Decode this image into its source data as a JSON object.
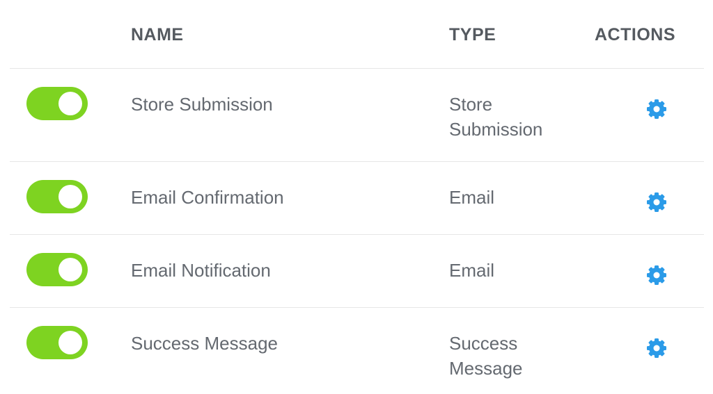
{
  "colors": {
    "toggle_on": "#7ed321",
    "gear": "#2b9be8",
    "text": "#646970",
    "header_text": "#555a60",
    "divider": "#e6e6e6"
  },
  "header": {
    "name": "NAME",
    "type": "TYPE",
    "actions": "ACTIONS"
  },
  "rows": [
    {
      "enabled": true,
      "name": "Store Submission",
      "type": "Store Submission",
      "action_icon": "gear-icon"
    },
    {
      "enabled": true,
      "name": "Email Confirmation",
      "type": "Email",
      "action_icon": "gear-icon"
    },
    {
      "enabled": true,
      "name": "Email Notification",
      "type": "Email",
      "action_icon": "gear-icon"
    },
    {
      "enabled": true,
      "name": "Success Message",
      "type": "Success Message",
      "action_icon": "gear-icon"
    }
  ]
}
